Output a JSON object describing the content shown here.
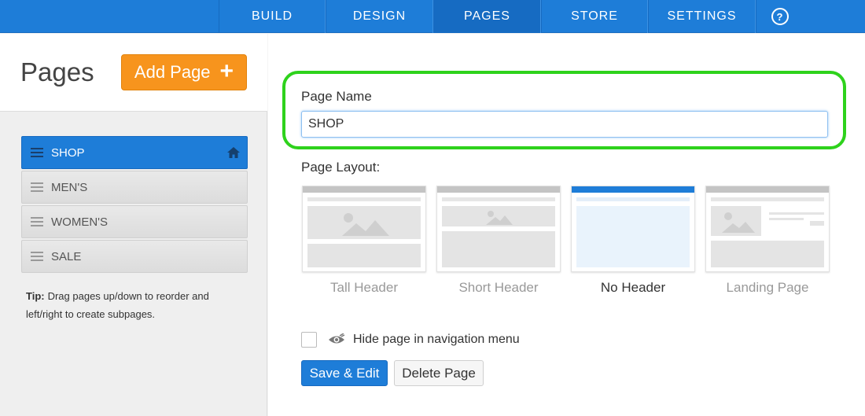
{
  "nav": {
    "items": [
      {
        "label": "BUILD",
        "active": false
      },
      {
        "label": "DESIGN",
        "active": false
      },
      {
        "label": "PAGES",
        "active": true
      },
      {
        "label": "STORE",
        "active": false
      },
      {
        "label": "SETTINGS",
        "active": false
      }
    ],
    "help_label": "?"
  },
  "sidebar": {
    "title": "Pages",
    "add_button_label": "Add Page",
    "add_button_icon": "+",
    "pages": [
      {
        "label": "SHOP",
        "active": true,
        "icon": "home-icon"
      },
      {
        "label": "MEN'S",
        "active": false
      },
      {
        "label": "WOMEN'S",
        "active": false
      },
      {
        "label": "SALE",
        "active": false
      }
    ],
    "tip_label": "Tip:",
    "tip_text": "Drag pages up/down to reorder and left/right to create subpages."
  },
  "main": {
    "page_name_label": "Page Name",
    "page_name_value": "SHOP",
    "page_layout_label": "Page Layout:",
    "layouts": [
      {
        "label": "Tall Header",
        "selected": false
      },
      {
        "label": "Short Header",
        "selected": false
      },
      {
        "label": "No Header",
        "selected": true
      },
      {
        "label": "Landing Page",
        "selected": false
      }
    ],
    "hide_nav_label": "Hide page in navigation menu",
    "hide_nav_checked": false,
    "save_button_label": "Save & Edit",
    "delete_button_label": "Delete Page"
  },
  "colors": {
    "primary_blue": "#1e7dd8",
    "add_orange": "#f7941d",
    "highlight_green": "#2ed21c"
  }
}
